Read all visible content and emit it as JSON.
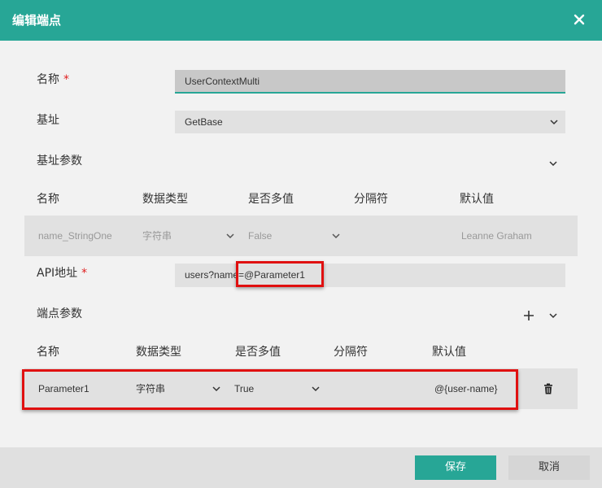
{
  "dialog": {
    "title": "编辑端点"
  },
  "form": {
    "name_label": "名称",
    "required_mark": "*",
    "name_value": "UserContextMulti",
    "base_label": "基址",
    "base_value": "GetBase",
    "base_params_label": "基址参数",
    "api_label": "API地址",
    "api_value": "users?name=@Parameter1",
    "endpoint_params_label": "端点参数"
  },
  "base_params": {
    "headers": [
      "名称",
      "数据类型",
      "是否多值",
      "分隔符",
      "默认值"
    ],
    "rows": [
      {
        "name": "name_StringOne",
        "type": "字符串",
        "multi": "False",
        "separator": "",
        "default": "Leanne Graham"
      }
    ]
  },
  "endpoint_params": {
    "headers": [
      "名称",
      "数据类型",
      "是否多值",
      "分隔符",
      "默认值"
    ],
    "rows": [
      {
        "name": "Parameter1",
        "type": "字符串",
        "multi": "True",
        "separator": "",
        "default": "@{user-name}"
      }
    ]
  },
  "footer": {
    "save_label": "保存",
    "cancel_label": "取消"
  },
  "colors": {
    "accent": "#27a696",
    "highlight": "#e01010"
  },
  "icons": [
    "close-icon",
    "chevron-down-icon",
    "plus-icon",
    "trash-icon"
  ]
}
